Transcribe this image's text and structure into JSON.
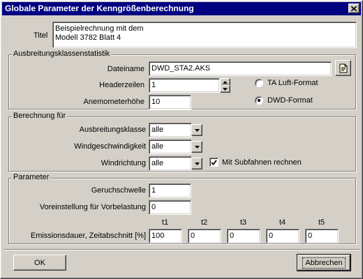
{
  "window": {
    "title": "Globale Parameter der Kenngrößenberechnung"
  },
  "titel": {
    "label": "Titel",
    "value": "Beispielrechnung mit dem\nModell 3782 Blatt 4"
  },
  "ausbreitung": {
    "group_title": "Ausbreitungsklassenstatistik",
    "dateiname_label": "Dateiname",
    "dateiname_value": "DWD_STA2.AKS",
    "headerzeilen_label": "Headerzeilen",
    "headerzeilen_value": "1",
    "anemometer_label": "Anemometerhöhe",
    "anemometer_value": "10",
    "radio_ta_label": "TA Luft-Format",
    "radio_dwd_label": "DWD-Format"
  },
  "berechnung": {
    "group_title": "Berechnung für",
    "klasse_label": "Ausbreitungsklasse",
    "klasse_value": "alle",
    "wind_label": "Windgeschwindigkeit",
    "wind_value": "alle",
    "richtung_label": "Windrichtung",
    "richtung_value": "alle",
    "subfahnen_label": "Mit Subfahnen rechnen"
  },
  "parameter": {
    "group_title": "Parameter",
    "geruch_label": "Geruchschwelle",
    "geruch_value": "1",
    "vorbelastung_label": "Voreinstellung für Vorbelastung",
    "vorbelastung_value": "0",
    "emission_label": "Emissionsdauer, Zeitabschnitt [%]",
    "columns": [
      "t1",
      "t2",
      "t3",
      "t4",
      "t5"
    ],
    "emission_values": [
      "100",
      "0",
      "0",
      "0",
      "0"
    ]
  },
  "buttons": {
    "ok": "OK",
    "abbrechen": "Abbrechen"
  }
}
